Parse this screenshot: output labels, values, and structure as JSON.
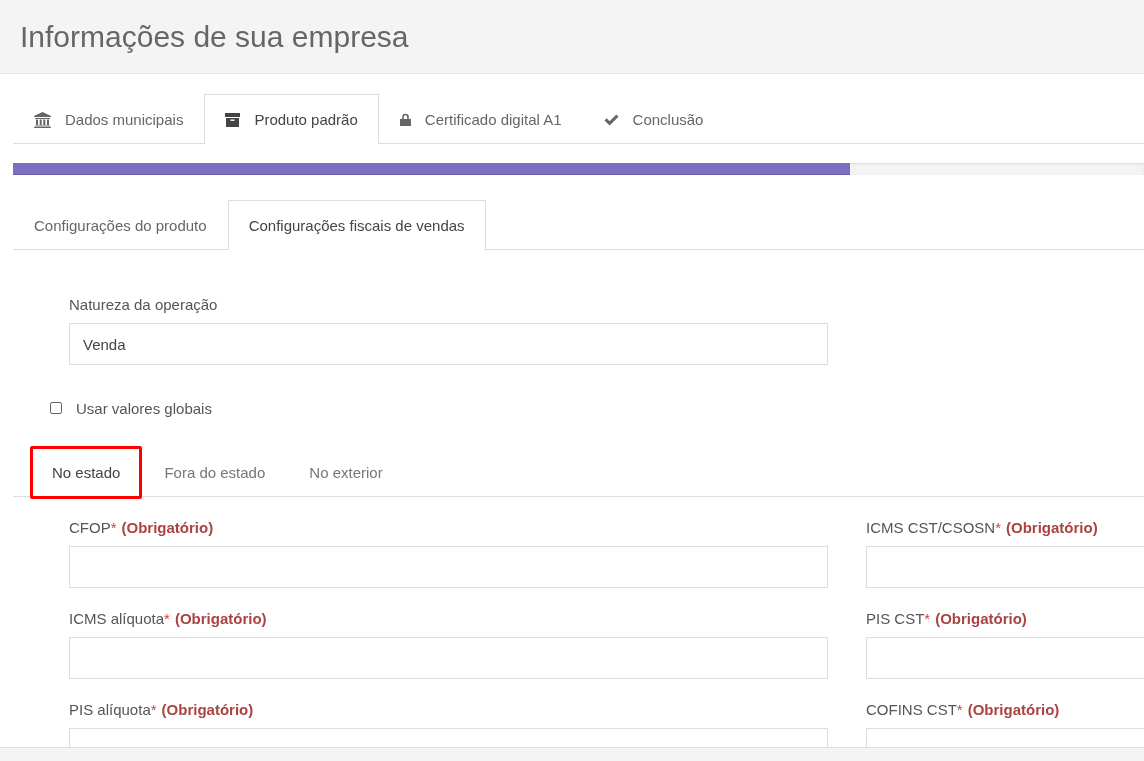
{
  "page_title": "Informações de sua empresa",
  "steps": [
    {
      "label": "Dados municipais",
      "kind": "bank",
      "selected": false
    },
    {
      "label": "Produto padrão",
      "kind": "box",
      "selected": true
    },
    {
      "label": "Certificado digital A1",
      "kind": "lock",
      "selected": false
    },
    {
      "label": "Conclusão",
      "kind": "check",
      "selected": false
    }
  ],
  "progress": {
    "level": 0.74
  },
  "subtabs": [
    {
      "label": "Configurações do produto",
      "selected": false
    },
    {
      "label": "Configurações fiscais de vendas",
      "selected": true
    }
  ],
  "operation_nature": {
    "label": "Natureza da operação",
    "value": "Venda"
  },
  "use_global_values": {
    "label": "Usar valores globais",
    "checked": false
  },
  "region_tabs": [
    {
      "label": "No estado",
      "selected": true,
      "highlighted": true
    },
    {
      "label": "Fora do estado",
      "selected": false,
      "highlighted": false
    },
    {
      "label": "No exterior",
      "selected": false,
      "highlighted": false
    }
  ],
  "fields": [
    {
      "label": "CFOP",
      "asterisk": "*",
      "note": "(Obrigatório)"
    },
    {
      "label": "ICMS CST/CSOSN",
      "asterisk": "*",
      "note": "(Obrigatório)"
    },
    {
      "label": "ICMS alíquota",
      "asterisk": "*",
      "note": "(Obrigatório)"
    },
    {
      "label": "PIS CST",
      "asterisk": "*",
      "note": "(Obrigatório)"
    },
    {
      "label": "PIS alíquota",
      "asterisk": "*",
      "note": "(Obrigatório)"
    },
    {
      "label": "COFINS CST",
      "asterisk": "*",
      "note": "(Obrigatório)"
    }
  ]
}
